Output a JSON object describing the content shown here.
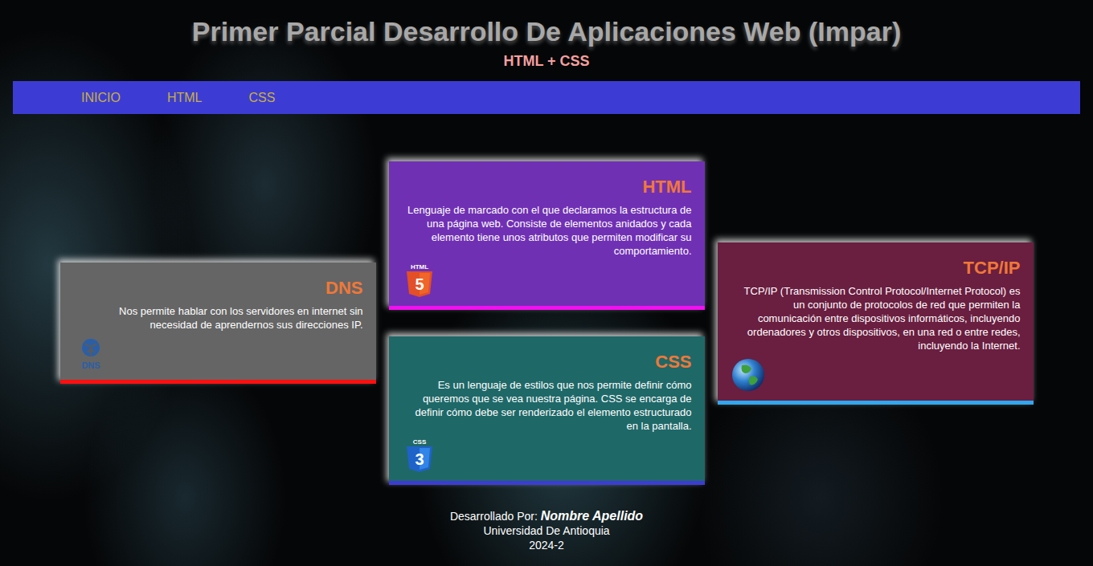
{
  "header": {
    "title": "Primer Parcial Desarrollo De Aplicaciones Web (Impar)",
    "subtitle": "HTML + CSS"
  },
  "nav": [
    "INICIO",
    "HTML",
    "CSS"
  ],
  "columns": [
    [
      {
        "title": "DNS",
        "text": "Nos permite hablar con los servidores en internet sin necesidad de aprendernos sus direcciones IP.",
        "color": "#656565",
        "border_color": "#ff1010",
        "icon": {
          "kind": "dns",
          "caption": "DNS"
        }
      }
    ],
    [
      {
        "title": "HTML",
        "text": "Lenguaje de marcado con el que declaramos la estructura de una página web. Consiste de elementos anidados y cada elemento tiene unos atributos que permiten modificar su comportamiento.",
        "color": "#7030b4",
        "border_color": "#f010f0",
        "icon": {
          "kind": "html5",
          "caption": "HTML",
          "glyph": "5"
        }
      },
      {
        "title": "CSS",
        "text": "Es un lenguaje de estilos que nos permite definir cómo queremos que se vea nuestra página. CSS se encarga de definir cómo debe ser renderizado el elemento estructurado en la pantalla.",
        "color": "#1f6868",
        "border_color": "#3c3cd4",
        "icon": {
          "kind": "css3",
          "caption": "CSS",
          "glyph": "3"
        }
      }
    ],
    [
      {
        "title": "TCP/IP",
        "text": "TCP/IP (Transmission Control Protocol/Internet Protocol) es un conjunto de protocolos de red que permiten la comunicación entre dispositivos informáticos, incluyendo ordenadores y otros dispositivos, en una red o entre redes, incluyendo la Internet.",
        "color": "#6a1e40",
        "border_color": "#30a8f0",
        "icon": {
          "kind": "globe"
        }
      }
    ]
  ],
  "footer": {
    "prefix": "Desarrollado Por:",
    "name": "Nombre Apellido",
    "university": "Universidad De Antioquia",
    "year": "2024-2"
  }
}
